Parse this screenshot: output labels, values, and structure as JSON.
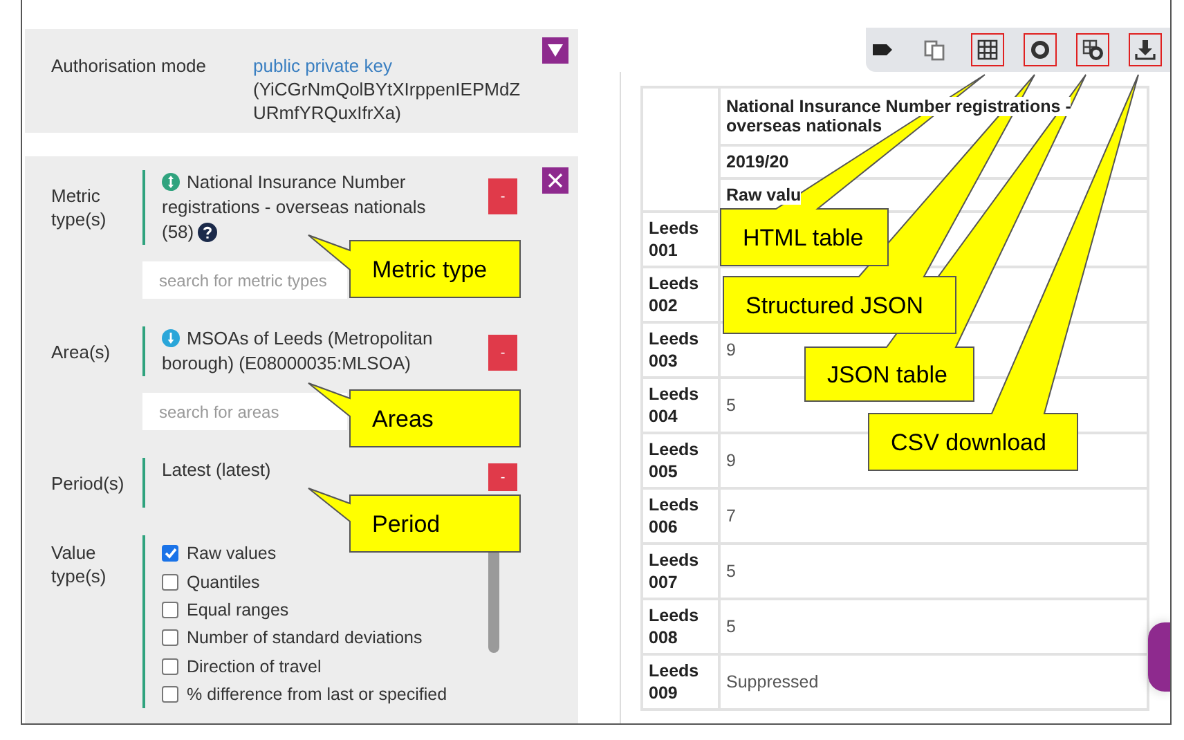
{
  "authorisation": {
    "label": "Authorisation mode",
    "mode": "public private key",
    "key": "(YiCGrNmQolBYtXIrppenIEPMdZURmfYRQuxIfrXa)",
    "expanded": false
  },
  "filters": [
    {
      "kind": "selection",
      "label": "Metric type(s)",
      "text": "National Insurance Number registrations - overseas nationals (58)",
      "help": true,
      "remove": "-",
      "placeholder": "search for metric types"
    },
    {
      "kind": "selection",
      "label": "Area(s)",
      "text": "MSOAs of Leeds (Metropolitan borough) (E08000035:MLSOA)",
      "help": false,
      "remove": "-",
      "placeholder": "search for areas"
    },
    {
      "kind": "selection",
      "label": "Period(s)",
      "text": "Latest (latest)",
      "help": false,
      "remove": "-"
    },
    {
      "kind": "checklist",
      "label": "Value type(s)",
      "options": [
        {
          "label": "Raw values",
          "checked": true
        },
        {
          "label": "Quantiles",
          "checked": false
        },
        {
          "label": "Equal ranges",
          "checked": false
        },
        {
          "label": "Number of standard deviations",
          "checked": false
        },
        {
          "label": "Direction of travel",
          "checked": false
        },
        {
          "label": "% difference from last or specified",
          "checked": false
        }
      ]
    }
  ],
  "toolbar": [
    {
      "kind": "tag",
      "highlighted": false
    },
    {
      "kind": "copy",
      "highlighted": false
    },
    {
      "kind": "table",
      "highlighted": true
    },
    {
      "kind": "ring",
      "highlighted": true
    },
    {
      "kind": "table-ring",
      "highlighted": true
    },
    {
      "kind": "download",
      "highlighted": true
    }
  ],
  "table": {
    "header": "National Insurance Number registrations - overseas nationals",
    "period": "2019/20",
    "value_type": "Raw valu",
    "rows": [
      {
        "area": "Leeds 001"
      },
      {
        "area": "Leeds 002"
      },
      {
        "area": "Leeds 003",
        "value": "9"
      },
      {
        "area": "Leeds 004",
        "value": "5"
      },
      {
        "area": "Leeds 005",
        "value": "9"
      },
      {
        "area": "Leeds 006",
        "value": "7"
      },
      {
        "area": "Leeds 007",
        "value": "5"
      },
      {
        "area": "Leeds 008",
        "value": "5"
      },
      {
        "area": "Leeds 009",
        "value": "Suppressed"
      }
    ]
  },
  "callouts": [
    {
      "text": "HTML table"
    },
    {
      "text": "Structured JSON"
    },
    {
      "text": "JSON table"
    },
    {
      "text": "CSV download"
    },
    {
      "text": "Metric type"
    },
    {
      "text": "Areas"
    },
    {
      "text": "Period"
    }
  ]
}
